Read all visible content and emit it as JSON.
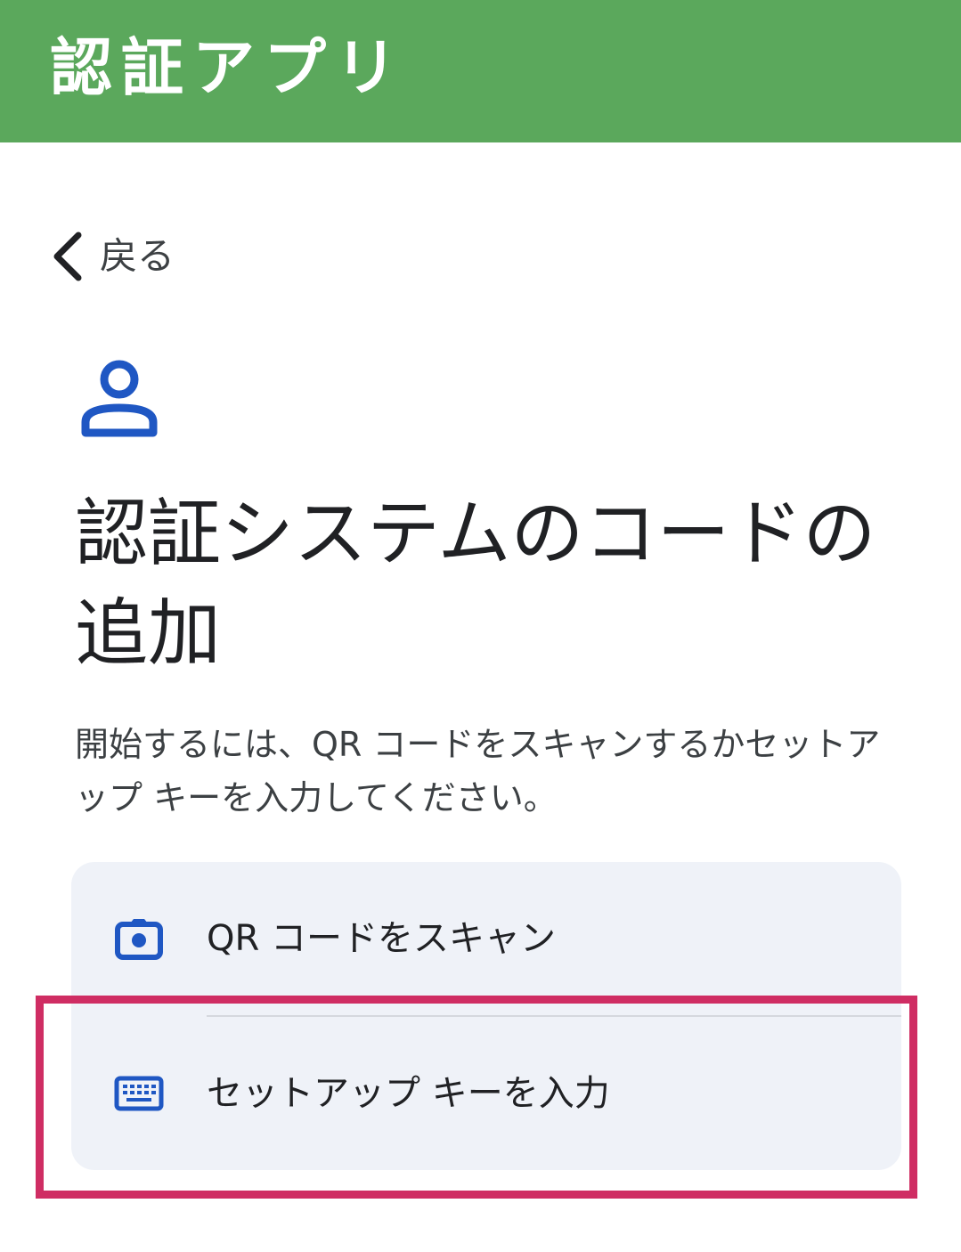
{
  "banner": {
    "title": "認証アプリ",
    "color": "#5ba85c"
  },
  "back": {
    "label": "戻る",
    "icon": "chevron-left-icon"
  },
  "header": {
    "icon": "account-icon",
    "title": "認証システムのコードの追加"
  },
  "instructions": "開始するには、QR コードをスキャンするかセットアップ キーを入力してください。",
  "options": [
    {
      "label": "QR コードをスキャン",
      "icon": "camera-icon"
    },
    {
      "label": "セットアップ キーを入力",
      "icon": "keyboard-icon"
    }
  ],
  "colors": {
    "accent": "#1f57c3",
    "card_background": "#eff2f8",
    "highlight": "#cf2d63"
  }
}
